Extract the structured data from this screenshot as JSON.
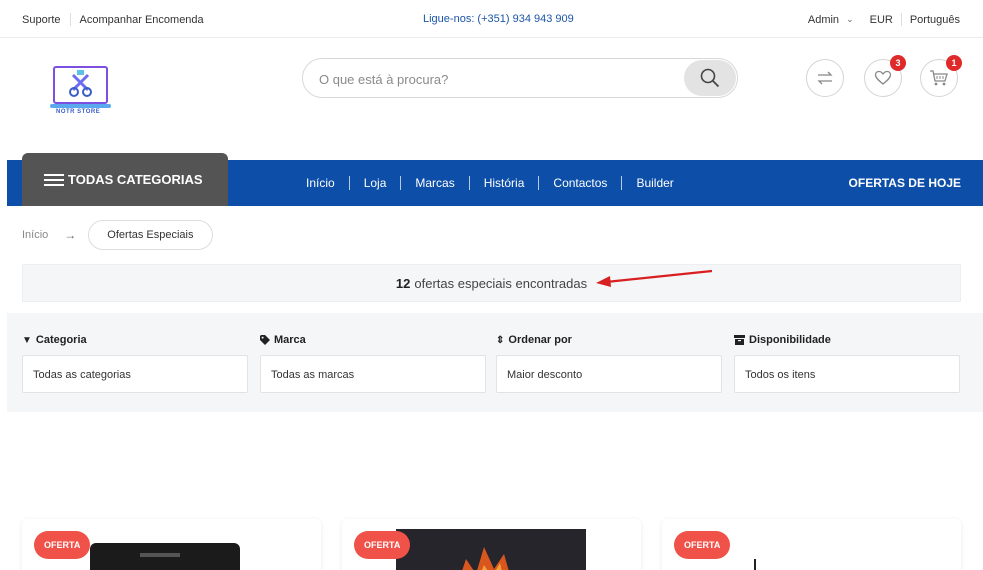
{
  "topbar": {
    "support": "Suporte",
    "track": "Acompanhar Encomenda",
    "phone": "Ligue-nos: (+351) 934 943 909",
    "account": "Admin",
    "currency": "EUR",
    "language": "Português"
  },
  "logo": {
    "text": "NOTR STORE"
  },
  "search": {
    "placeholder": "O que está à procura?"
  },
  "header_icons": {
    "compare": "compare-icon",
    "wishlist": "heart-icon",
    "wishlist_count": "3",
    "cart": "cart-icon",
    "cart_count": "1"
  },
  "nav": {
    "categories": "TODAS CATEGORIAS",
    "links": [
      "Início",
      "Loja",
      "Marcas",
      "História",
      "Contactos",
      "Builder"
    ],
    "offers": "OFERTAS DE HOJE"
  },
  "breadcrumb": {
    "home": "Início",
    "current": "Ofertas Especiais"
  },
  "results": {
    "count": "12",
    "text": "ofertas especiais encontradas"
  },
  "filters": [
    {
      "label": "Categoria",
      "value": "Todas as categorias",
      "icon": "funnel-icon"
    },
    {
      "label": "Marca",
      "value": "Todas as marcas",
      "icon": "tag-icon"
    },
    {
      "label": "Ordenar por",
      "value": "Maior desconto",
      "icon": "sort-icon"
    },
    {
      "label": "Disponibilidade",
      "value": "Todos os itens",
      "icon": "box-icon"
    }
  ],
  "products": [
    {
      "badge": "OFERTA"
    },
    {
      "badge": "OFERTA"
    },
    {
      "badge": "OFERTA"
    }
  ],
  "colors": {
    "brand_blue": "#0c4ea8",
    "category_button": "#545454",
    "offer_badge": "#f0524a",
    "badge_red": "#e02a2a"
  }
}
